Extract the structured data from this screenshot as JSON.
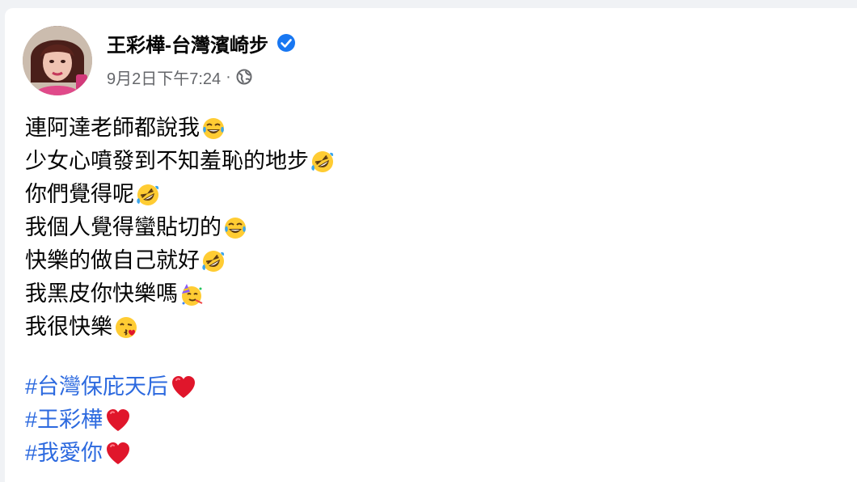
{
  "post": {
    "author": "王彩樺-台灣濱崎步",
    "verified_icon": "verified-badge-icon",
    "timestamp": "9月2日下午7:24",
    "separator": "·",
    "audience_icon": "globe-icon",
    "lines": [
      {
        "text": "連阿達老師都說我",
        "emoji": "grinning-sweat-tears"
      },
      {
        "text": "少女心噴發到不知羞恥的地步",
        "emoji": "rolling-on-floor-laughing"
      },
      {
        "text": "你們覺得呢",
        "emoji": "rolling-on-floor-laughing"
      },
      {
        "text": "我個人覺得蠻貼切的",
        "emoji": "grinning-sweat-tears"
      },
      {
        "text": "快樂的做自己就好",
        "emoji": "rolling-on-floor-laughing"
      },
      {
        "text": "我黑皮你快樂嗎",
        "emoji": "partying-face"
      },
      {
        "text": "我很快樂",
        "emoji": "face-blowing-kiss"
      }
    ],
    "hashtags": [
      {
        "text": "#台灣保庇天后",
        "emoji": "red-heart"
      },
      {
        "text": "#王彩樺",
        "emoji": "red-heart"
      },
      {
        "text": "#我愛你",
        "emoji": "red-heart"
      }
    ]
  },
  "colors": {
    "background": "#f0f2f5",
    "card": "#ffffff",
    "text": "#050505",
    "secondary": "#65676b",
    "hashtag": "#2d6adf",
    "verified": "#1877f2",
    "heart": "#e0162b",
    "emoji_face": "#ffcc33"
  }
}
